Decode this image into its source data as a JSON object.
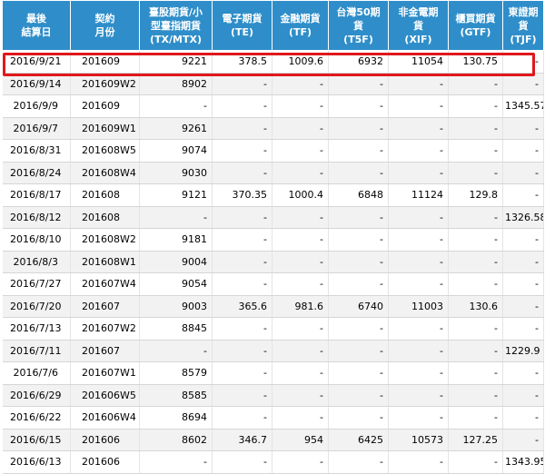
{
  "table": {
    "headers": [
      "最後\n結算日",
      "契約\n月份",
      "臺股期貨/小\n型臺指期貨\n(TX/MTX)",
      "電子期貨\n(TE)",
      "金融期貨\n(TF)",
      "台灣50期\n貨\n(T5F)",
      "非金電期\n貨\n(XIF)",
      "櫃買期貨\n(GTF)",
      "東證期貨\n(TJF)"
    ],
    "rows": [
      [
        "2016/9/21",
        "201609",
        "9221",
        "378.5",
        "1009.6",
        "6932",
        "11054",
        "130.75",
        "-"
      ],
      [
        "2016/9/14",
        "201609W2",
        "8902",
        "-",
        "-",
        "-",
        "-",
        "-",
        "-"
      ],
      [
        "2016/9/9",
        "201609",
        "-",
        "-",
        "-",
        "-",
        "-",
        "-",
        "1345.57"
      ],
      [
        "2016/9/7",
        "201609W1",
        "9261",
        "-",
        "-",
        "-",
        "-",
        "-",
        "-"
      ],
      [
        "2016/8/31",
        "201608W5",
        "9074",
        "-",
        "-",
        "-",
        "-",
        "-",
        "-"
      ],
      [
        "2016/8/24",
        "201608W4",
        "9030",
        "-",
        "-",
        "-",
        "-",
        "-",
        "-"
      ],
      [
        "2016/8/17",
        "201608",
        "9121",
        "370.35",
        "1000.4",
        "6848",
        "11124",
        "129.8",
        "-"
      ],
      [
        "2016/8/12",
        "201608",
        "-",
        "-",
        "-",
        "-",
        "-",
        "-",
        "1326.58"
      ],
      [
        "2016/8/10",
        "201608W2",
        "9181",
        "-",
        "-",
        "-",
        "-",
        "-",
        "-"
      ],
      [
        "2016/8/3",
        "201608W1",
        "9004",
        "-",
        "-",
        "-",
        "-",
        "-",
        "-"
      ],
      [
        "2016/7/27",
        "201607W4",
        "9054",
        "-",
        "-",
        "-",
        "-",
        "-",
        "-"
      ],
      [
        "2016/7/20",
        "201607",
        "9003",
        "365.6",
        "981.6",
        "6740",
        "11003",
        "130.6",
        "-"
      ],
      [
        "2016/7/13",
        "201607W2",
        "8845",
        "-",
        "-",
        "-",
        "-",
        "-",
        "-"
      ],
      [
        "2016/7/11",
        "201607",
        "-",
        "-",
        "-",
        "-",
        "-",
        "-",
        "1229.9"
      ],
      [
        "2016/7/6",
        "201607W1",
        "8579",
        "-",
        "-",
        "-",
        "-",
        "-",
        "-"
      ],
      [
        "2016/6/29",
        "201606W5",
        "8585",
        "-",
        "-",
        "-",
        "-",
        "-",
        "-"
      ],
      [
        "2016/6/22",
        "201606W4",
        "8694",
        "-",
        "-",
        "-",
        "-",
        "-",
        "-"
      ],
      [
        "2016/6/15",
        "201606",
        "8602",
        "346.7",
        "954",
        "6425",
        "10573",
        "127.25",
        "-"
      ],
      [
        "2016/6/13",
        "201606",
        "-",
        "-",
        "-",
        "-",
        "-",
        "-",
        "1343.95"
      ]
    ]
  },
  "colors": {
    "header_bg": "#2f8ec9",
    "header_text": "#ffffff",
    "row_alt_bg": "#f2f2f2",
    "highlight_border": "#e0181b"
  }
}
